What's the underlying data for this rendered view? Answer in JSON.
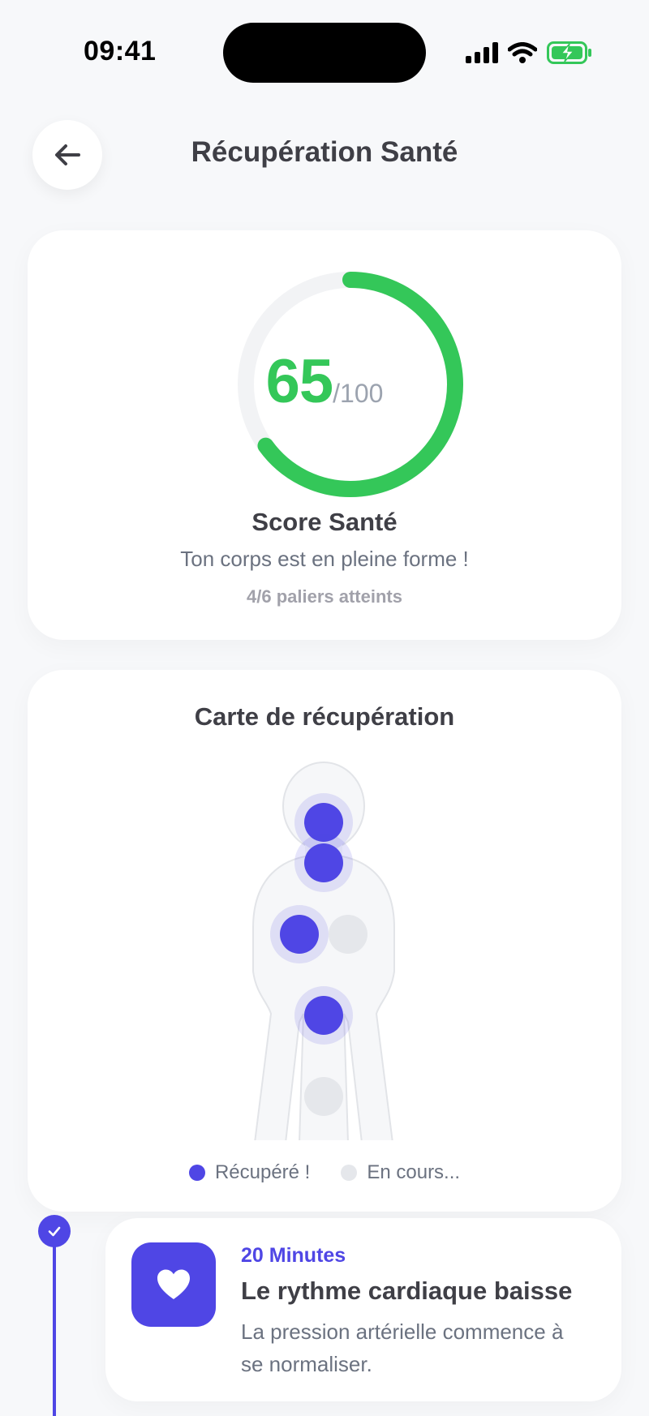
{
  "status_bar": {
    "time": "09:41",
    "icons": [
      "signal-icon",
      "wifi-icon",
      "battery-charging-icon"
    ]
  },
  "header": {
    "back_icon": "arrow-left-icon",
    "title": "Récupération Santé"
  },
  "score_card": {
    "score": "65",
    "max": "/100",
    "progress_fraction": 0.65,
    "title": "Score Santé",
    "subtitle": "Ton corps est en pleine forme !",
    "milestones_text": "4/6 paliers atteints",
    "ring_color": "#34c759",
    "track_color": "#f2f3f5"
  },
  "recovery_map": {
    "title": "Carte de récupération",
    "points": [
      {
        "name": "head",
        "status": "recovered"
      },
      {
        "name": "neck",
        "status": "recovered"
      },
      {
        "name": "left-lung",
        "status": "recovered"
      },
      {
        "name": "right-lung",
        "status": "in-progress"
      },
      {
        "name": "stomach",
        "status": "recovered"
      },
      {
        "name": "pelvis",
        "status": "in-progress"
      }
    ],
    "legend": {
      "recovered": "Récupéré !",
      "in_progress": "En cours..."
    },
    "colors": {
      "recovered": "#4f46e5",
      "in_progress": "#e5e7eb"
    }
  },
  "timeline": {
    "milestone": {
      "icon": "heart-icon",
      "time": "20 Minutes",
      "title": "Le rythme cardiaque baisse",
      "description": "La pression artérielle commence à se normaliser.",
      "completed": true
    }
  }
}
